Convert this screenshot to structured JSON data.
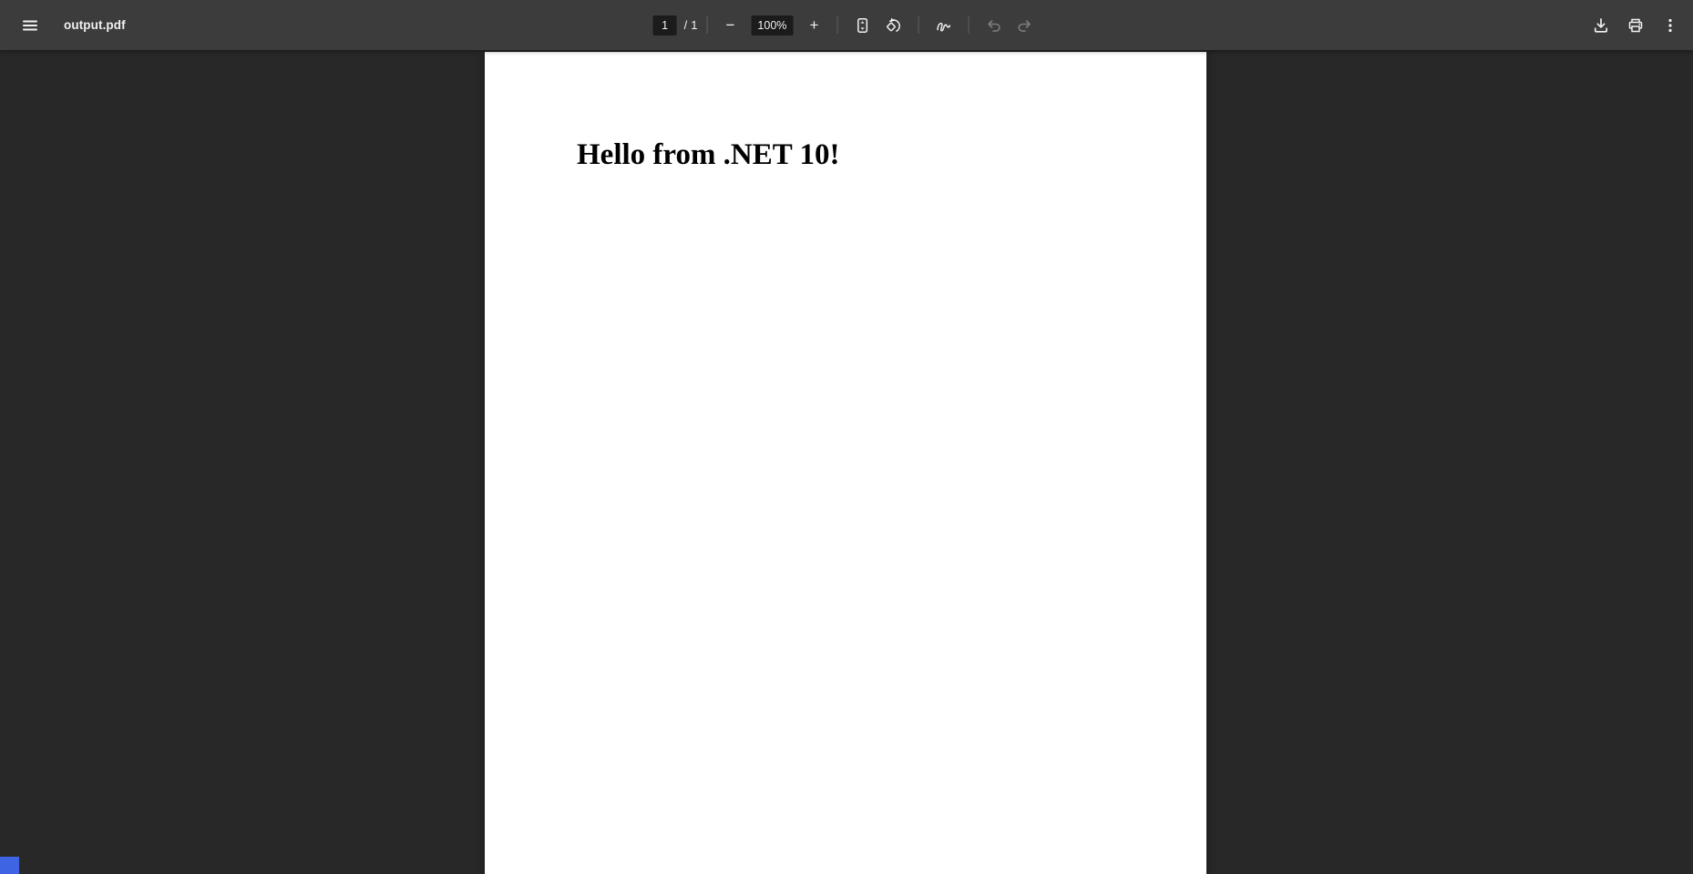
{
  "toolbar": {
    "title": "output.pdf",
    "pager": {
      "current_page": "1",
      "separator": "/",
      "total_pages": "1"
    },
    "zoom": {
      "minus_label": "−",
      "value": "100%",
      "plus_label": "+"
    },
    "icons": {
      "menu": "hamburger-menu",
      "fit_page": "fit-to-page-toggle",
      "rotate": "rotate-counterclockwise",
      "annotate": "draw-annotate-pen",
      "undo": "undo-disabled",
      "redo": "redo-disabled",
      "download": "download",
      "print": "print",
      "more": "more-actions-kebab"
    }
  },
  "document": {
    "heading": "Hello from .NET 10!"
  },
  "colors": {
    "toolbar_bg": "#3c3c3c",
    "viewer_bg": "#282828",
    "field_bg": "#1b1b1b",
    "icon": "#f1f1f1",
    "icon_disabled": "#7c7c7c",
    "page_bg": "#ffffff",
    "status_bubble_blue": "#3e63e3"
  }
}
